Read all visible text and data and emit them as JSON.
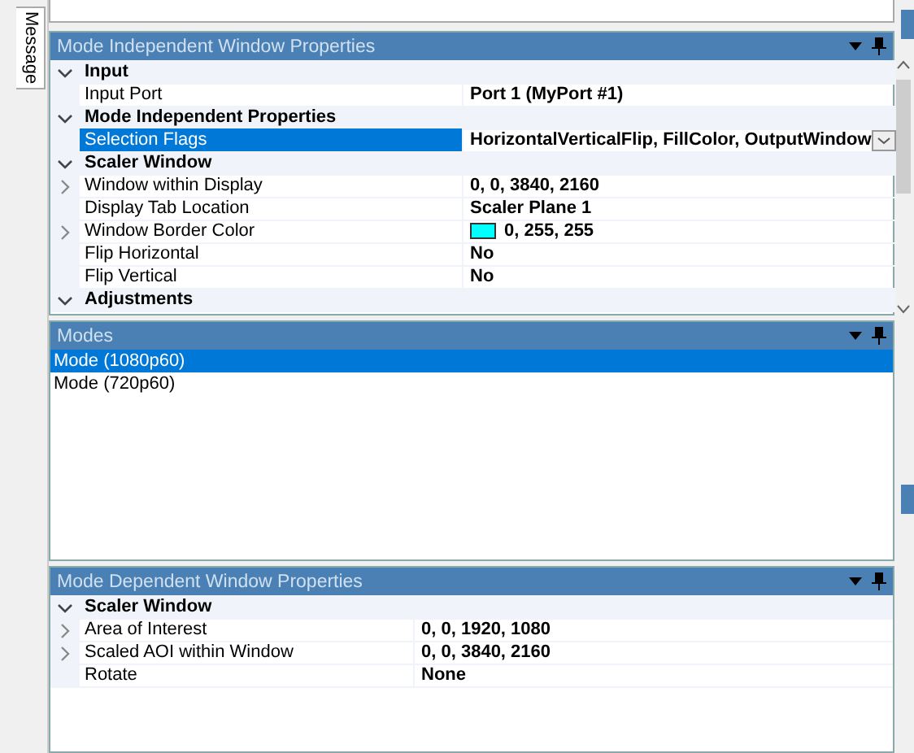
{
  "side_tab": {
    "label": "Message"
  },
  "panels": [
    {
      "title": "Mode Independent Window Properties",
      "kind": "properties",
      "rows": [
        {
          "kind": "category",
          "label": "Input",
          "expanded": true
        },
        {
          "kind": "property",
          "name": "Input Port",
          "value": "Port 1 (MyPort #1)",
          "expandable": false,
          "selected": false
        },
        {
          "kind": "category",
          "label": "Mode Independent Properties",
          "expanded": true
        },
        {
          "kind": "property",
          "name": "Selection Flags",
          "value": "HorizontalVerticalFlip, FillColor, OutputWindow",
          "expandable": false,
          "selected": true
        },
        {
          "kind": "category",
          "label": "Scaler Window",
          "expanded": true
        },
        {
          "kind": "property",
          "name": "Window within Display",
          "value": "0, 0, 3840, 2160",
          "expandable": true,
          "selected": false
        },
        {
          "kind": "property",
          "name": "Display Tab Location",
          "value": "Scaler Plane 1",
          "expandable": false,
          "selected": false
        },
        {
          "kind": "property",
          "name": "Window Border Color",
          "value": "0, 255, 255",
          "expandable": true,
          "selected": false,
          "color": "#00ffff"
        },
        {
          "kind": "property",
          "name": "Flip Horizontal",
          "value": "No",
          "expandable": false,
          "selected": false
        },
        {
          "kind": "property",
          "name": "Flip Vertical",
          "value": "No",
          "expandable": false,
          "selected": false
        },
        {
          "kind": "category",
          "label": "Adjustments",
          "expanded": true
        }
      ]
    },
    {
      "title": "Modes",
      "kind": "list",
      "items": [
        {
          "label": "Mode (1080p60)",
          "selected": true
        },
        {
          "label": "Mode (720p60)",
          "selected": false
        }
      ]
    },
    {
      "title": "Mode Dependent Window Properties",
      "kind": "properties",
      "rows": [
        {
          "kind": "category",
          "label": "Scaler Window",
          "expanded": true
        },
        {
          "kind": "property",
          "name": "Area of Interest",
          "value": "0, 0, 1920, 1080",
          "expandable": true,
          "selected": false
        },
        {
          "kind": "property",
          "name": "Scaled AOI within Window",
          "value": "0, 0, 3840, 2160",
          "expandable": true,
          "selected": false
        },
        {
          "kind": "property",
          "name": "Rotate",
          "value": "None",
          "expandable": false,
          "selected": false
        }
      ]
    }
  ]
}
